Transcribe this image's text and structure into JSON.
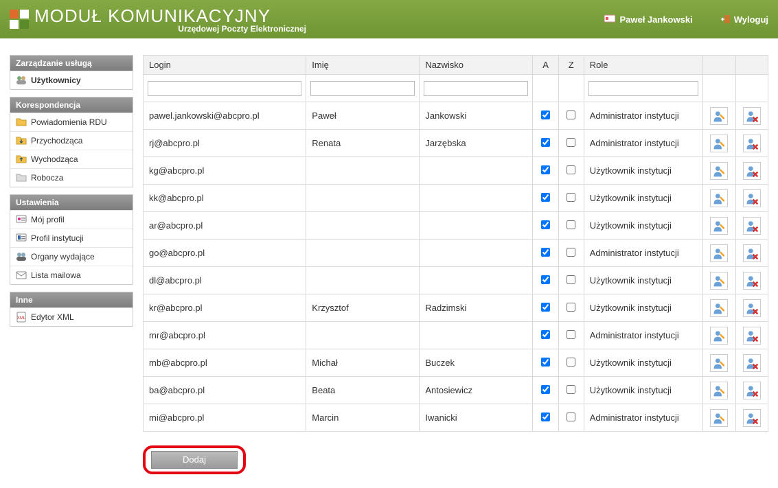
{
  "header": {
    "title": "MODUŁ KOMUNIKACYJNY",
    "subtitle": "Urzędowej Poczty Elektronicznej",
    "user": "Paweł Jankowski",
    "logout": "Wyloguj"
  },
  "sidebar": {
    "groups": [
      {
        "title": "Zarządzanie usługą",
        "items": [
          {
            "label": "Użytkownicy",
            "icon": "users-icon",
            "active": true
          }
        ]
      },
      {
        "title": "Korespondencja",
        "items": [
          {
            "label": "Powiadomienia RDU",
            "icon": "folder-yellow-icon"
          },
          {
            "label": "Przychodząca",
            "icon": "folder-in-icon"
          },
          {
            "label": "Wychodząca",
            "icon": "folder-out-icon"
          },
          {
            "label": "Robocza",
            "icon": "folder-draft-icon"
          }
        ]
      },
      {
        "title": "Ustawienia",
        "items": [
          {
            "label": "Mój profil",
            "icon": "profile-icon"
          },
          {
            "label": "Profil instytucji",
            "icon": "institution-icon"
          },
          {
            "label": "Organy wydające",
            "icon": "organs-icon"
          },
          {
            "label": "Lista mailowa",
            "icon": "mail-list-icon"
          }
        ]
      },
      {
        "title": "Inne",
        "items": [
          {
            "label": "Edytor XML",
            "icon": "xml-icon"
          }
        ]
      }
    ]
  },
  "table": {
    "headers": {
      "login": "Login",
      "imie": "Imię",
      "nazwisko": "Nazwisko",
      "a": "A",
      "z": "Z",
      "role": "Role"
    },
    "filters": {
      "login": "",
      "imie": "",
      "nazwisko": "",
      "role": ""
    },
    "rows": [
      {
        "login": "pawel.jankowski@abcpro.pl",
        "imie": "Paweł",
        "nazwisko": "Jankowski",
        "a": true,
        "z": false,
        "role": "Administrator instytucji"
      },
      {
        "login": "rj@abcpro.pl",
        "imie": "Renata",
        "nazwisko": "Jarzębska",
        "a": true,
        "z": false,
        "role": "Administrator instytucji"
      },
      {
        "login": "kg@abcpro.pl",
        "imie": "",
        "nazwisko": "",
        "a": true,
        "z": false,
        "role": "Użytkownik instytucji"
      },
      {
        "login": "kk@abcpro.pl",
        "imie": "",
        "nazwisko": "",
        "a": true,
        "z": false,
        "role": "Użytkownik instytucji"
      },
      {
        "login": "ar@abcpro.pl",
        "imie": "",
        "nazwisko": "",
        "a": true,
        "z": false,
        "role": "Użytkownik instytucji"
      },
      {
        "login": "go@abcpro.pl",
        "imie": "",
        "nazwisko": "",
        "a": true,
        "z": false,
        "role": "Administrator instytucji"
      },
      {
        "login": "dl@abcpro.pl",
        "imie": "",
        "nazwisko": "",
        "a": true,
        "z": false,
        "role": "Użytkownik instytucji"
      },
      {
        "login": "kr@abcpro.pl",
        "imie": "Krzysztof",
        "nazwisko": "Radzimski",
        "a": true,
        "z": false,
        "role": "Użytkownik instytucji"
      },
      {
        "login": "mr@abcpro.pl",
        "imie": "",
        "nazwisko": "",
        "a": true,
        "z": false,
        "role": "Administrator instytucji"
      },
      {
        "login": "mb@abcpro.pl",
        "imie": "Michał",
        "nazwisko": "Buczek",
        "a": true,
        "z": false,
        "role": "Użytkownik instytucji"
      },
      {
        "login": "ba@abcpro.pl",
        "imie": "Beata",
        "nazwisko": "Antosiewicz",
        "a": true,
        "z": false,
        "role": "Użytkownik instytucji"
      },
      {
        "login": "mi@abcpro.pl",
        "imie": "Marcin",
        "nazwisko": "Iwanicki",
        "a": true,
        "z": false,
        "role": "Administrator instytucji"
      }
    ]
  },
  "buttons": {
    "dodaj": "Dodaj"
  }
}
